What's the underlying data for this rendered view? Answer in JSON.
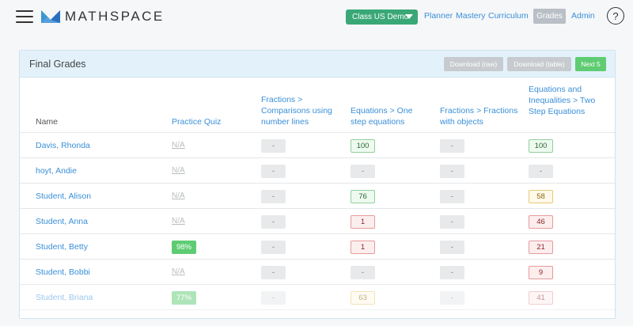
{
  "brand": {
    "name": "MATHSPACE"
  },
  "header": {
    "class_selector": "Class US Demo",
    "nav": [
      "Planner",
      "Mastery",
      "Curriculum"
    ],
    "active_nav": "Grades",
    "admin": "Admin",
    "help": "?"
  },
  "card": {
    "title": "Final Grades",
    "download_raw": "Download (raw)",
    "download_table": "Download (table)",
    "next": "Next 5"
  },
  "columns": {
    "name": "Name",
    "c1": "Practice Quiz",
    "c2": "Fractions > Comparisons using number lines",
    "c3": "Equations > One step equations",
    "c4": "Fractions > Fractions with objects",
    "c5": "Equations and Inequalities > Two Step Equations"
  },
  "rows": [
    {
      "name": "Davis, Rhonda",
      "c1": "N/A",
      "c2": "-",
      "c3": "100",
      "c4": "-",
      "c5": "100"
    },
    {
      "name": "hoyt, Andie",
      "c1": "N/A",
      "c2": "-",
      "c3": "-",
      "c4": "-",
      "c5": "-"
    },
    {
      "name": "Student, Alison",
      "c1": "N/A",
      "c2": "-",
      "c3": "76",
      "c4": "-",
      "c5": "58"
    },
    {
      "name": "Student, Anna",
      "c1": "N/A",
      "c2": "-",
      "c3": "1",
      "c4": "-",
      "c5": "46"
    },
    {
      "name": "Student, Betty",
      "c1": "98%",
      "c2": "-",
      "c3": "1",
      "c4": "-",
      "c5": "21"
    },
    {
      "name": "Student, Bobbi",
      "c1": "N/A",
      "c2": "-",
      "c3": "-",
      "c4": "-",
      "c5": "9"
    },
    {
      "name": "Student, Briana",
      "c1": "77%",
      "c2": "-",
      "c3": "63",
      "c4": "-",
      "c5": "41"
    }
  ],
  "colors": {
    "accent_green": "#3aa876",
    "link_blue": "#3a8fd8",
    "grade_high": "#8fd09a",
    "grade_mid": "#e8c978",
    "grade_low": "#e69a9a"
  },
  "icons": [
    "hamburger-menu-icon",
    "mathspace-logo-icon",
    "dropdown-caret-icon",
    "help-icon"
  ]
}
